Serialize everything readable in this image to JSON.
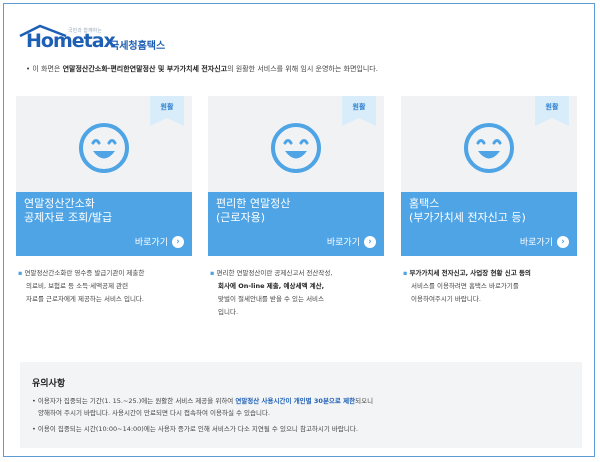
{
  "header": {
    "logo_text": "Hometax",
    "logo_tagline": "국민과 함께하는",
    "org_name": "국세청홈택스"
  },
  "intro": {
    "prefix": "• 이 화면은 ",
    "bold": "연말정산간소화·편리한연말정산 및 부가가치세 전자신고",
    "suffix": "의 원활한 서비스를 위해 임시 운영하는 화면입니다."
  },
  "cards": [
    {
      "badge": "원활",
      "title_line1": "연말정산간소화",
      "title_line2": "공제자료 조회/발급",
      "link_label": "바로가기",
      "desc": [
        {
          "t": "연말정산간소화란 영수증 발급기관이 제출한",
          "b": false
        },
        {
          "t": "의료비, 보험료 등 소득·세액공제 관련",
          "b": false
        },
        {
          "t": "자료를 근로자에게 제공하는 서비스 입니다.",
          "b": false
        }
      ]
    },
    {
      "badge": "원활",
      "title_line1": "편리한 연말정산",
      "title_line2": "(근로자용)",
      "link_label": "바로가기",
      "desc": [
        {
          "t": "편리한 연말정산이란 공제신고서 전산작성,",
          "b": false
        },
        {
          "t": "회사에 On-line 제출, 예상세액 계산,",
          "b": true
        },
        {
          "t": "맞벌이 절세안내를 받을 수 있는 서비스",
          "b": false
        },
        {
          "t": "입니다.",
          "b": false
        }
      ]
    },
    {
      "badge": "원활",
      "title_line1": "홈택스",
      "title_line2": "(부가가치세 전자신고 등)",
      "link_label": "바로가기",
      "desc": [
        {
          "t": "부가가치세 전자신고, 사업장 현황 신고 등의",
          "b": true
        },
        {
          "t": "서비스를 이용하려면 홈택스 바로가기를",
          "b": false
        },
        {
          "t": "이용하여주시기 바랍니다.",
          "b": false
        }
      ]
    }
  ],
  "notice": {
    "title": "유의사항",
    "line1_prefix": "• 이용자가 집중되는 기간(1. 15.~25.)에는 원활한 서비스 제공을 위하여 ",
    "line1_highlight": "연말정산 사용시간이 개인별 30분으로 제한",
    "line1_suffix": "되오니",
    "line2": "양해하여 주시기 바랍니다. 사용시간이 만료되면 다시 접속하여 이용하실 수 있습니다.",
    "line3": "• 이용이 집중되는 시간(10:00~14:00)에는 사용자 증가로 인해 서비스가 다소 지연될 수 있으니 참고하시기 바랍니다."
  },
  "colors": {
    "accent": "#4fa4e6",
    "brand": "#1d5fb4",
    "card_bg": "#f1f2f4"
  }
}
